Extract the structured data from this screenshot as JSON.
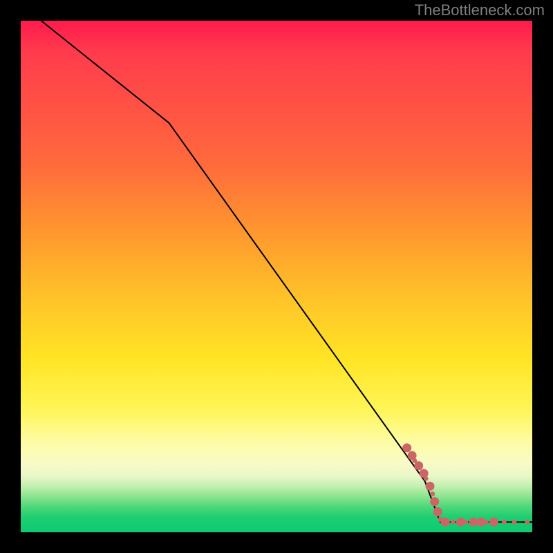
{
  "watermark": "TheBottleneck.com",
  "chart_data": {
    "type": "line",
    "title": "",
    "xlabel": "",
    "ylabel": "",
    "xlim": [
      0,
      100
    ],
    "ylim": [
      0,
      100
    ],
    "grid": false,
    "legend": false,
    "series": [
      {
        "name": "curve",
        "x": [
          4,
          29,
          79,
          82,
          100
        ],
        "values": [
          100,
          80,
          10,
          2,
          2
        ],
        "color": "#000000"
      }
    ],
    "markers": {
      "name": "highlighted-points",
      "color": "#cc6666",
      "radius_small": 3.5,
      "radius_large": 6.5,
      "points": [
        {
          "x": 75.5,
          "y": 16.5,
          "r": "large"
        },
        {
          "x": 76.5,
          "y": 15.0,
          "r": "large"
        },
        {
          "x": 77.0,
          "y": 14.0,
          "r": "small"
        },
        {
          "x": 77.8,
          "y": 13.0,
          "r": "large"
        },
        {
          "x": 78.8,
          "y": 11.5,
          "r": "large"
        },
        {
          "x": 79.2,
          "y": 10.5,
          "r": "small"
        },
        {
          "x": 80.0,
          "y": 9.0,
          "r": "large"
        },
        {
          "x": 80.5,
          "y": 7.5,
          "r": "small"
        },
        {
          "x": 80.9,
          "y": 6.0,
          "r": "large"
        },
        {
          "x": 81.5,
          "y": 4.0,
          "r": "large"
        },
        {
          "x": 82.0,
          "y": 2.5,
          "r": "small"
        },
        {
          "x": 83.0,
          "y": 2.0,
          "r": "large"
        },
        {
          "x": 84.5,
          "y": 2.0,
          "r": "small"
        },
        {
          "x": 86.0,
          "y": 2.0,
          "r": "large"
        },
        {
          "x": 87.0,
          "y": 2.0,
          "r": "small"
        },
        {
          "x": 88.5,
          "y": 2.0,
          "r": "large"
        },
        {
          "x": 90.0,
          "y": 2.0,
          "r": "large"
        },
        {
          "x": 91.0,
          "y": 2.0,
          "r": "small"
        },
        {
          "x": 92.5,
          "y": 2.0,
          "r": "large"
        },
        {
          "x": 94.5,
          "y": 2.0,
          "r": "small"
        },
        {
          "x": 96.5,
          "y": 2.0,
          "r": "small"
        },
        {
          "x": 99.0,
          "y": 2.0,
          "r": "small"
        }
      ]
    },
    "background": {
      "type": "vertical-gradient",
      "stops": [
        {
          "pos": 0.0,
          "color": "#ff1a4d"
        },
        {
          "pos": 0.3,
          "color": "#ff7a38"
        },
        {
          "pos": 0.55,
          "color": "#ffd028"
        },
        {
          "pos": 0.78,
          "color": "#fff24a"
        },
        {
          "pos": 0.88,
          "color": "#f4f9c0"
        },
        {
          "pos": 0.94,
          "color": "#7ee28c"
        },
        {
          "pos": 1.0,
          "color": "#0acb73"
        }
      ]
    }
  }
}
